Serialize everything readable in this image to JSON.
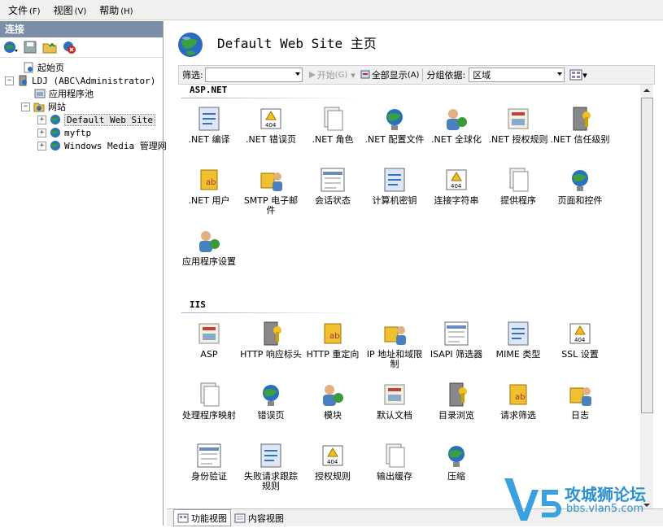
{
  "menubar": {
    "items": [
      {
        "label": "文件",
        "accel": "(F)"
      },
      {
        "label": "视图",
        "accel": "(V)"
      },
      {
        "label": "帮助",
        "accel": "(H)"
      }
    ]
  },
  "left": {
    "header": "连接",
    "tree": [
      {
        "label": "起始页"
      },
      {
        "label": "LDJ (ABC\\Administrator)"
      },
      {
        "label": "应用程序池"
      },
      {
        "label": "网站"
      },
      {
        "label": "Default Web Site"
      },
      {
        "label": "myftp"
      },
      {
        "label": "Windows Media 管理网"
      }
    ]
  },
  "main": {
    "title": "Default Web Site 主页",
    "filter": {
      "label": "筛选:",
      "value": "",
      "start_label": "开始",
      "start_accel": "(G)",
      "show_all_label": "全部显示",
      "show_all_accel": "(A)",
      "group_label": "分组依据:",
      "group_value": "区域"
    },
    "sections": [
      {
        "title": "ASP.NET",
        "items": [
          ".NET 编译",
          ".NET 错误页",
          ".NET 角色",
          ".NET 配置文件",
          ".NET 全球化",
          ".NET 授权规则",
          ".NET 信任级别",
          ".NET 用户",
          "SMTP 电子邮件",
          "会话状态",
          "计算机密钥",
          "连接字符串",
          "提供程序",
          "页面和控件",
          "应用程序设置"
        ]
      },
      {
        "title": "IIS",
        "items": [
          "ASP",
          "HTTP 响应标头",
          "HTTP 重定向",
          "IP 地址和域限制",
          "ISAPI 筛选器",
          "MIME 类型",
          "SSL 设置",
          "处理程序映射",
          "错误页",
          "模块",
          "默认文档",
          "目录浏览",
          "请求筛选",
          "日志",
          "身份验证",
          "失败请求跟踪规则",
          "授权规则",
          "输出缓存",
          "压缩"
        ]
      }
    ]
  },
  "bottom_tabs": [
    {
      "label": "功能视图"
    },
    {
      "label": "内容视图"
    }
  ],
  "watermark": {
    "brand": "V5",
    "name": "攻城狮论坛",
    "url": "bbs.vlan5.com"
  }
}
